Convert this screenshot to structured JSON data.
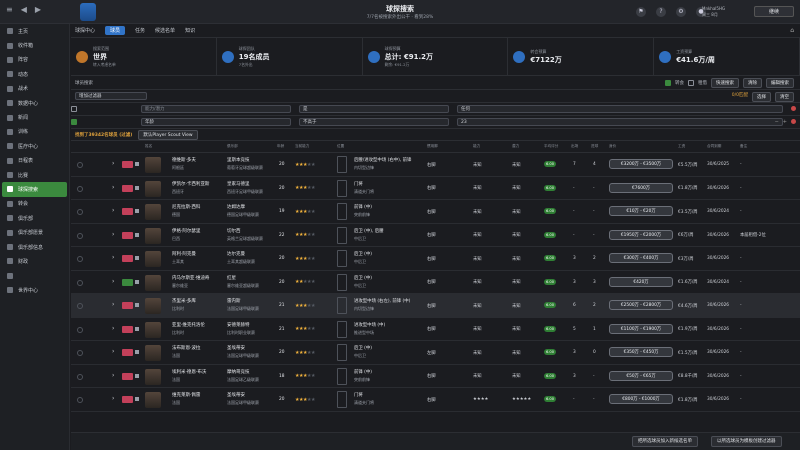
{
  "topbar": {
    "title": "球探搜索",
    "subtitle": "7/7名被搜索外出公干 · 看到28%",
    "user_name": "Mnkhal5HG",
    "user_sub": "周三 8月",
    "continue_label": "继续",
    "icon_names": [
      "pin-icon",
      "help-icon",
      "settings-icon",
      "user-icon"
    ]
  },
  "sidebar": {
    "items": [
      {
        "label": "主页",
        "active": false
      },
      {
        "label": "收件箱",
        "active": false
      },
      {
        "label": "阵容",
        "active": false
      },
      {
        "label": "动态",
        "active": false
      },
      {
        "label": "战术",
        "active": false
      },
      {
        "label": "数据中心",
        "active": false
      },
      {
        "label": "新闻",
        "active": false
      },
      {
        "label": "训练",
        "active": false
      },
      {
        "label": "医疗中心",
        "active": false
      },
      {
        "label": "日程表",
        "active": false
      },
      {
        "label": "比赛",
        "active": false
      },
      {
        "label": "球探搜索",
        "active": true
      },
      {
        "label": "转会",
        "active": false
      },
      {
        "label": "俱乐部",
        "active": false
      },
      {
        "label": "俱乐部愿景",
        "active": false
      },
      {
        "label": "俱乐部信息",
        "active": false
      },
      {
        "label": "财政",
        "active": false
      },
      {
        "label": "",
        "active": false
      },
      {
        "label": "世界中心",
        "active": false
      }
    ]
  },
  "tabs": [
    {
      "label": "球探中心",
      "selected": false
    },
    {
      "label": "球员",
      "selected": true
    },
    {
      "label": "任务",
      "selected": false
    },
    {
      "label": "候选名单",
      "selected": false
    },
    {
      "label": "知识",
      "selected": false
    }
  ],
  "kpis": [
    {
      "label": "搜索范围",
      "value": "世界",
      "sub": "转入考虑名单"
    },
    {
      "label": "球探团队",
      "value": "19名成员",
      "sub": "7名外出"
    },
    {
      "label": "球探预算",
      "value": "总计: €91.2万",
      "sub": "剩余: €91.2万"
    },
    {
      "label": "转会预算",
      "value": "€7122万",
      "sub": ""
    },
    {
      "label": "工资预算",
      "value": "€41.6万/周",
      "sub": ""
    }
  ],
  "toolbar": {
    "left_label": "球员搜索",
    "check1": "转会",
    "check2": "租借",
    "quick_search": "快速搜索",
    "rescan": "清除",
    "ready": "编辑搜索",
    "count": "0/0匹配",
    "apply": "选择",
    "clear": "清空"
  },
  "filter_rows": [
    {
      "label": "增加过滤器",
      "f1": "",
      "f2": "",
      "f3": ""
    },
    {
      "label": "",
      "f1": "能力/潜力",
      "f2": "是",
      "f3": "任何"
    },
    {
      "label": "",
      "f1": "年龄",
      "f2": "不高于",
      "f3": "23"
    }
  ],
  "results": {
    "count_label": "找到了39342名球员 (过滤)",
    "view_label": "默认Player Scout View"
  },
  "columns": {
    "name": "姓名",
    "club": "俱乐部",
    "age": "年龄",
    "ca": "当前能力",
    "pos": "位置",
    "foot": "惯用脚",
    "pot": "能力",
    "pa": "潜力",
    "avg": "平均评分",
    "apps": "出场",
    "goals": "进球",
    "value": "身价",
    "wage": "工资",
    "expires": "合同到期",
    "note": "备注"
  },
  "rows": [
    {
      "name": "德维斯·多夫",
      "nat": "阿根廷",
      "club": "里斯本竞技",
      "league": "葡萄牙足球超级联赛",
      "age": "20",
      "stars": 3,
      "pos": "后腰/进攻型中场 (右中), 前锋",
      "role": "内切型边锋",
      "foot": "右脚",
      "kn1": "未知",
      "kn2": "未知",
      "pill": "6.00",
      "apps": "7",
      "goals": "4",
      "value": "€3200万 - €3500万",
      "wage": "€5.5万/周",
      "expires": "30/6/2025",
      "note": "-",
      "hl": false,
      "badge": "red"
    },
    {
      "name": "伊凯尔·卡西利亚斯",
      "nat": "西班牙",
      "club": "皇家马德里",
      "league": "西班牙足球甲级联赛",
      "age": "20",
      "stars": 3,
      "pos": "门将",
      "role": "清道夫门将",
      "foot": "右脚",
      "kn1": "未知",
      "kn2": "未知",
      "pill": "6.00",
      "apps": "-",
      "goals": "-",
      "value": "€7600万",
      "wage": "€1.8万/周",
      "expires": "30/6/2026",
      "note": "-",
      "hl": false,
      "badge": "red"
    },
    {
      "name": "尼克拉斯·西科",
      "nat": "德国",
      "club": "达姆达摩",
      "league": "德国足球甲级联赛",
      "age": "19",
      "stars": 3,
      "pos": "前锋 (中)",
      "role": "突前前锋",
      "foot": "右脚",
      "kn1": "未知",
      "kn2": "未知",
      "pill": "6.00",
      "apps": "-",
      "goals": "-",
      "value": "€10万 - €20万",
      "wage": "€3.5万/周",
      "expires": "30/6/2024",
      "note": "-",
      "hl": false,
      "badge": "red"
    },
    {
      "name": "伊格·阿尔瑟里",
      "nat": "巴西",
      "club": "切尔西",
      "league": "英格兰足球超级联赛",
      "age": "22",
      "stars": 3,
      "pos": "后卫 (中), 后腰",
      "role": "中后卫",
      "foot": "右脚",
      "kn1": "未知",
      "kn2": "未知",
      "pill": "6.00",
      "apps": "-",
      "goals": "-",
      "value": "€1950万 - €2000万",
      "wage": "€6万/周",
      "expires": "30/6/2026",
      "note": "本届租借-2位",
      "hl": false,
      "badge": "red"
    },
    {
      "name": "阿利·阿克曼",
      "nat": "土耳其",
      "club": "达尔克曼",
      "league": "土耳其超级联赛",
      "age": "20",
      "stars": 3,
      "pos": "后卫 (中)",
      "role": "中后卫",
      "foot": "右脚",
      "kn1": "未知",
      "kn2": "未知",
      "pill": "6.00",
      "apps": "3",
      "goals": "2",
      "value": "€300万 - €400万",
      "wage": "€3万/周",
      "expires": "30/6/2026",
      "note": "-",
      "hl": false,
      "badge": "red"
    },
    {
      "name": "内马尔斯亚·维迪奇",
      "nat": "塞尔维亚",
      "club": "红星",
      "league": "塞尔维亚超级联赛",
      "age": "20",
      "stars": 2,
      "pos": "后卫 (中)",
      "role": "中后卫",
      "foot": "右脚",
      "kn1": "未知",
      "kn2": "未知",
      "pill": "6.00",
      "apps": "3",
      "goals": "3",
      "value": "€420万",
      "wage": "€1.6万/周",
      "expires": "30/6/2024",
      "note": "-",
      "hl": false,
      "badge": "green"
    },
    {
      "name": "杰里米·多库",
      "nat": "比利时",
      "club": "雷内斯",
      "league": "法国足球甲级联赛",
      "age": "21",
      "stars": 3,
      "pos": "进攻型中场 (右左), 前锋 (中)",
      "role": "内切型边锋",
      "foot": "右脚",
      "kn1": "未知",
      "kn2": "未知",
      "pill": "6.00",
      "apps": "6",
      "goals": "2",
      "value": "€2500万 - €2800万",
      "wage": "€4.6万/周",
      "expires": "30/6/2026",
      "note": "-",
      "hl": true,
      "badge": "red"
    },
    {
      "name": "亚里·维克托洛伦",
      "nat": "比利时",
      "club": "安德莱赫特",
      "league": "比利时职业联赛",
      "age": "21",
      "stars": 3,
      "pos": "进攻型中场 (中)",
      "role": "推进型中场",
      "foot": "右脚",
      "kn1": "未知",
      "kn2": "未知",
      "pill": "6.00",
      "apps": "5",
      "goals": "1",
      "value": "€1100万 - €1900万",
      "wage": "€1.9万/周",
      "expires": "30/6/2026",
      "note": "-",
      "hl": false,
      "badge": "red"
    },
    {
      "name": "法布斯恩·波拉",
      "nat": "法国",
      "club": "圣埃蒂安",
      "league": "法国足球甲级联赛",
      "age": "20",
      "stars": 3,
      "pos": "后卫 (中)",
      "role": "中后卫",
      "foot": "左脚",
      "kn1": "未知",
      "kn2": "未知",
      "pill": "6.00",
      "apps": "3",
      "goals": "0",
      "value": "€350万 - €450万",
      "wage": "€1.5万/周",
      "expires": "30/6/2026",
      "note": "-",
      "hl": false,
      "badge": "red"
    },
    {
      "name": "埃利米·德恩·布沃",
      "nat": "法国",
      "club": "摩纳哥竞技",
      "league": "法国足球乙级联赛",
      "age": "18",
      "stars": 3,
      "pos": "前锋 (中)",
      "role": "突前前锋",
      "foot": "右脚",
      "kn1": "未知",
      "kn2": "未知",
      "pill": "6.00",
      "apps": "3",
      "goals": "-",
      "value": "€50万 - €65万",
      "wage": "€8.8千/周",
      "expires": "30/6/2026",
      "note": "-",
      "hl": false,
      "badge": "red"
    },
    {
      "name": "维克莱斯·佩雷",
      "nat": "法国",
      "club": "圣埃蒂安",
      "league": "法国足球甲级联赛",
      "age": "20",
      "stars": 3,
      "pos": "门将",
      "role": "清道夫门将",
      "foot": "右脚",
      "kn1": "★★★★",
      "kn2": "★★★★★",
      "pill": "6.00",
      "apps": "-",
      "goals": "-",
      "value": "€800万 - €1000万",
      "wage": "€1.8万/周",
      "expires": "30/6/2026",
      "note": "-",
      "hl": false,
      "badge": "red"
    }
  ],
  "bottom": {
    "btn1": "把所选球员加入新候选名单",
    "btn2": "以所选球员为模板创建过滤器"
  }
}
